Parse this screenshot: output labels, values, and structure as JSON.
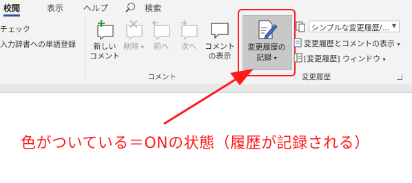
{
  "tabs": [
    {
      "label": "校閲",
      "active": true
    },
    {
      "label": "表示"
    },
    {
      "label": "ヘルプ"
    }
  ],
  "search": {
    "label": "検索",
    "icon": "search-icon"
  },
  "left_partial": {
    "item1": "チェック",
    "item2": "入力辞書への単語登録"
  },
  "comment_group": {
    "label": "コメント",
    "buttons": [
      {
        "label_line1": "新しい",
        "label_line2": "コメント",
        "icon": "new-comment-icon",
        "enabled": true
      },
      {
        "label_line1": "削除",
        "has_arrow": true,
        "icon": "delete-comment-icon",
        "enabled": false
      },
      {
        "label_line1": "前へ",
        "icon": "previous-comment-icon",
        "enabled": false
      },
      {
        "label_line1": "次へ",
        "icon": "next-comment-icon",
        "enabled": false
      },
      {
        "label_line1": "コメント",
        "label_line2": "の表示",
        "icon": "show-comments-icon",
        "enabled": true
      }
    ]
  },
  "tracking_group": {
    "label": "変更履歴",
    "track_changes": {
      "label_line1": "変更履歴の",
      "label_line2": "記録",
      "icon": "track-changes-icon",
      "active": true
    },
    "display_dropdown": {
      "value": "シンプルな変更履歴/..."
    },
    "show_markup": {
      "label": "変更履歴とコメントの表示",
      "icon": "show-markup-icon"
    },
    "reviewing_pane": {
      "label": "[変更履歴] ウィンドウ",
      "icon": "reviewing-pane-icon"
    }
  },
  "annotation": {
    "text": "色がついている＝ONの状態（履歴が記録される）",
    "color": "#ff1a1a"
  },
  "colors": {
    "ribbon_bg": "#f3f3f3",
    "active_button": "#c8c8c8",
    "highlight": "#ff1a1a",
    "accent": "#2b579a"
  }
}
